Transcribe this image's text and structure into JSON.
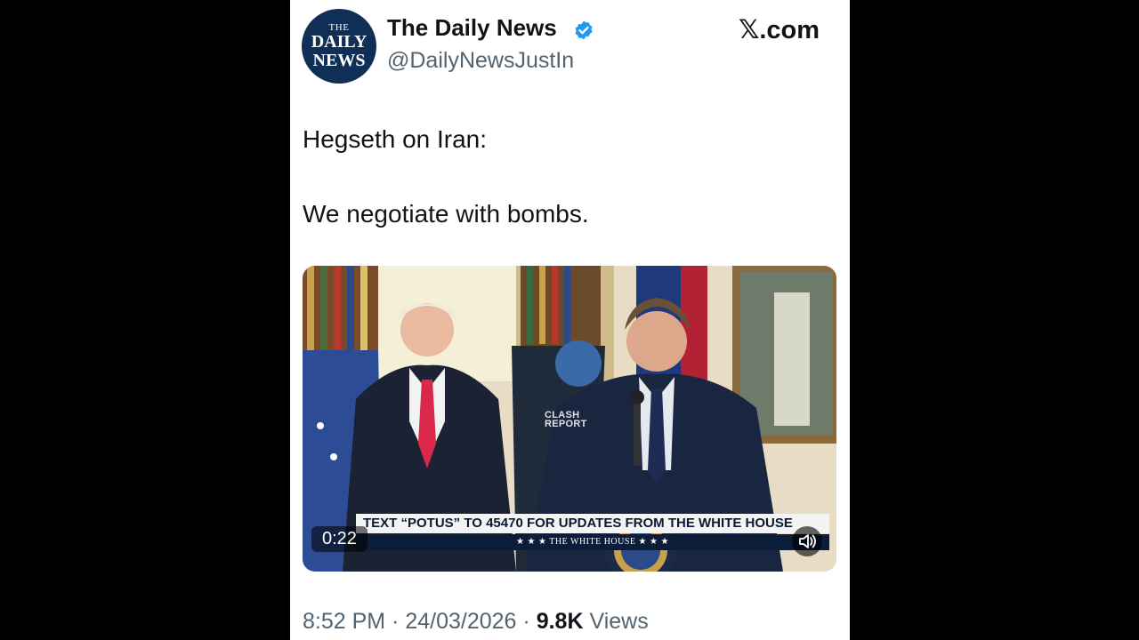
{
  "post": {
    "avatar": {
      "line1": "THE",
      "line2": "DAILY",
      "line3": "NEWS"
    },
    "author_name": "The Daily News",
    "handle": "@DailyNewsJustIn",
    "brand": "𝕏.com",
    "text_line1": "Hegseth on Iran:",
    "text_line2": "We negotiate with bombs.",
    "video": {
      "watermark_line1": "CLASH",
      "watermark_line2": "REPORT",
      "banner_text": "TEXT “POTUS” TO 45470 FOR UPDATES FROM THE WHITE HOUSE",
      "banner_subtext": "★ ★ ★   THE WHITE HOUSE   ★ ★ ★",
      "duration": "0:22"
    },
    "time": "8:52 PM",
    "date": "24/03/2026",
    "views_count": "9.8K",
    "views_label": "Views"
  },
  "colors": {
    "verified": "#1d9bf0",
    "text": "#0f1419",
    "secondary": "#536471",
    "avatar_bg": "#0f2f56"
  }
}
